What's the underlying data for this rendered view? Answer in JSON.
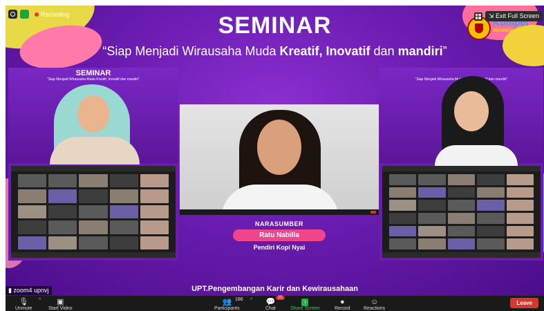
{
  "top_bar": {
    "recording_label": "Recording",
    "exit_fullscreen_label": "Exit Full Screen"
  },
  "banner": {
    "title": "SEMINAR",
    "subtitle_lead": "“Siap Menjadi Wirausaha Muda ",
    "subtitle_bold_1": "Kreatif, Inovatif",
    "subtitle_mid": " dan ",
    "subtitle_bold_2": "mandiri",
    "subtitle_end": "”",
    "logo_text": "Kompet",
    "logo_small": "INDONESIA JAYA"
  },
  "left_pane": {
    "mini_title": "SEMINAR",
    "mini_sub": "“Siap Menjadi Wirausaha Muda Kreatif, Inovatif dan mandiri”"
  },
  "right_pane": {
    "mini_sub": "“Siap Menjadi Wirausaha Muda Kreatif, Inovatif dan mandiri”"
  },
  "speaker": {
    "label": "NARASUMBER",
    "name": "Ratu Nabilla",
    "role": "Pendiri Kopi Nyai"
  },
  "footer": {
    "org": "UPT.Pengembangan Karir dan Kewirausahaan",
    "zoom_name": "zoom4 upnvj"
  },
  "toolbar": {
    "unmute": "Unmute",
    "start_video": "Start Video",
    "participants": "Participants",
    "participants_count": "186",
    "chat": "Chat",
    "chat_badge": "25",
    "share_screen": "Share Screen",
    "record": "Record",
    "reactions": "Reactions",
    "leave": "Leave"
  },
  "colors": {
    "banner_purple": "#6a1cb0",
    "speaker_pink": "#f0458a",
    "share_green": "#26b24a",
    "leave_red": "#d9352c"
  }
}
